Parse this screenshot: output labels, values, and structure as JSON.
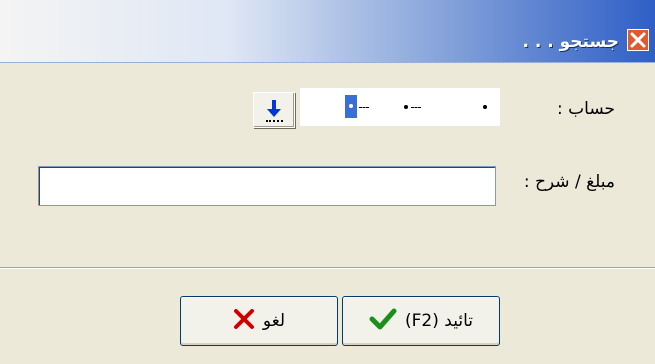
{
  "window": {
    "title": "جستجو . . ."
  },
  "form": {
    "account_label": "حساب :",
    "description_label": "مبلغ / شرح :",
    "description_value": ""
  },
  "buttons": {
    "ok_label": "تائید (F2)",
    "cancel_label": "لغو"
  },
  "icons": {
    "title": "close-icon",
    "browse": "down-arrow-icon",
    "ok": "checkmark-icon",
    "cancel": "x-icon"
  },
  "colors": {
    "titlebar_accent": "#2f5fc6",
    "ok_icon": "#1a8f1a",
    "cancel_icon": "#d10000",
    "arrow": "#0037d8"
  }
}
